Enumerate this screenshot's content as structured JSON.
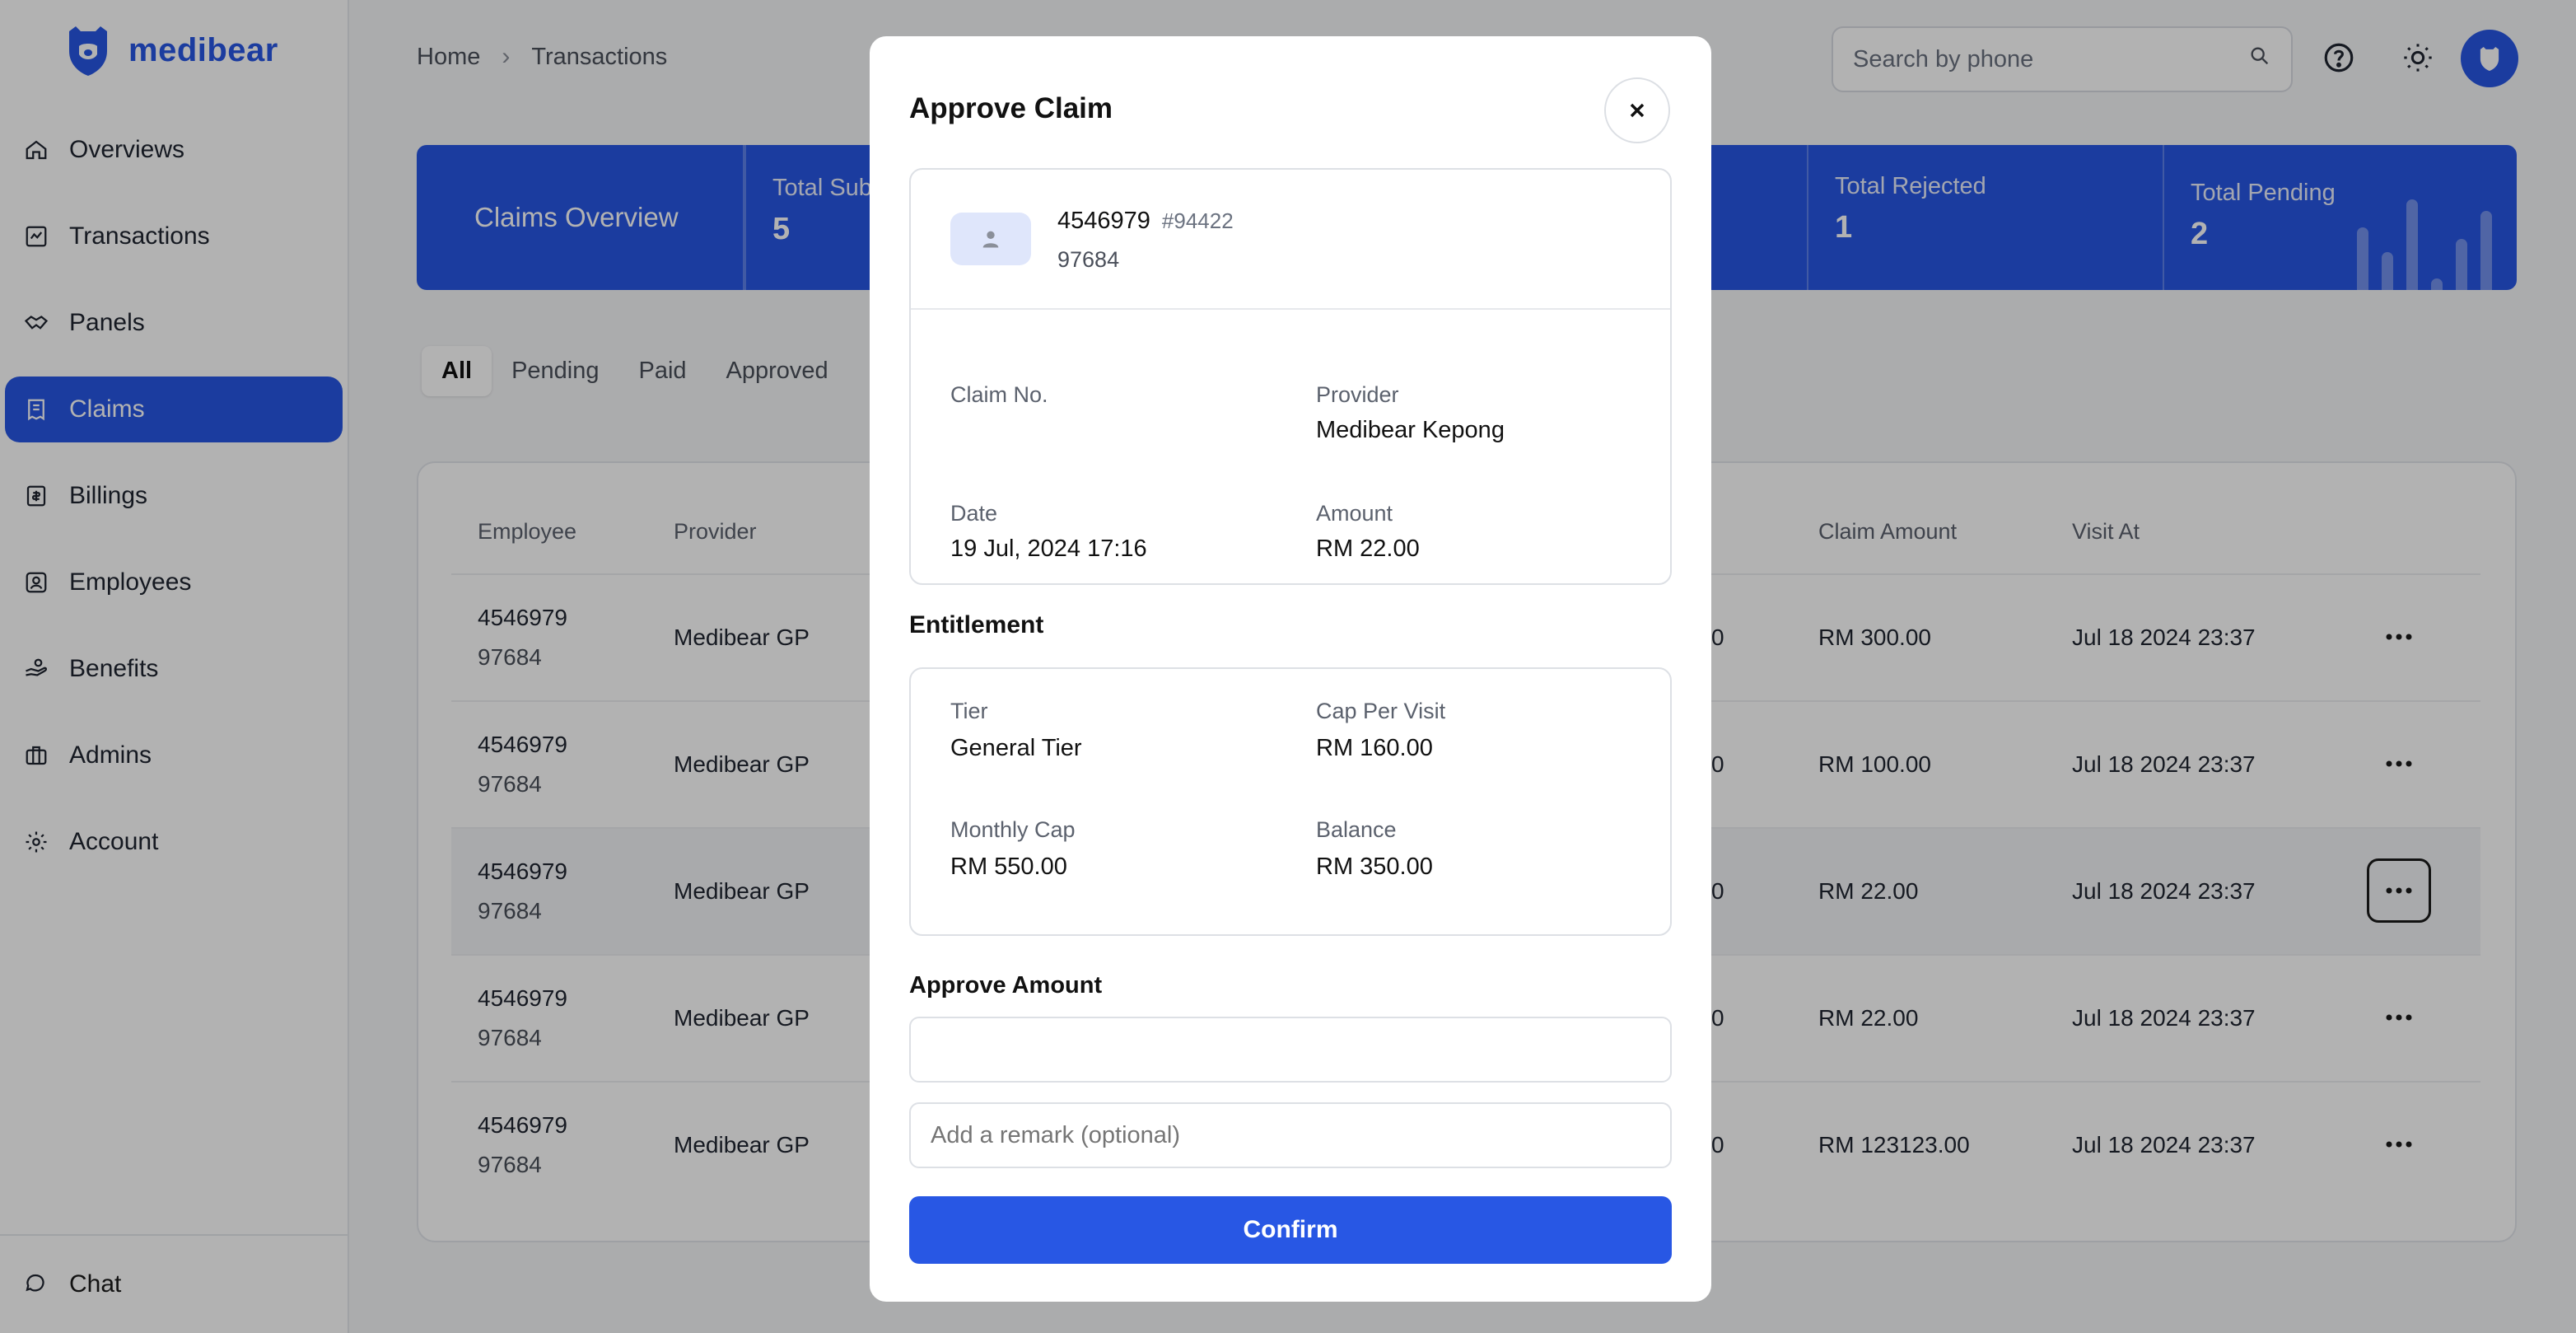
{
  "app": {
    "brand": "medibear",
    "accent": "#2857e4"
  },
  "sidebar": {
    "items": [
      {
        "label": "Overviews",
        "icon": "home-icon"
      },
      {
        "label": "Transactions",
        "icon": "transactions-icon"
      },
      {
        "label": "Panels",
        "icon": "handshake-icon"
      },
      {
        "label": "Claims",
        "icon": "receipt-icon",
        "active": true
      },
      {
        "label": "Billings",
        "icon": "billing-icon"
      },
      {
        "label": "Employees",
        "icon": "id-badge-icon"
      },
      {
        "label": "Benefits",
        "icon": "benefit-hand-icon"
      },
      {
        "label": "Admins",
        "icon": "briefcase-icon"
      },
      {
        "label": "Account",
        "icon": "gear-icon"
      }
    ],
    "footer": {
      "label": "Chat",
      "icon": "chat-icon"
    }
  },
  "header": {
    "breadcrumb": [
      "Home",
      "Transactions"
    ],
    "search_placeholder": "Search by phone"
  },
  "overview": {
    "title": "Claims Overview",
    "stats": [
      {
        "label": "Total Sub",
        "value": "5"
      },
      {
        "label": "Total Rejected",
        "value": "1"
      },
      {
        "label": "Total Pending",
        "value": "2"
      }
    ]
  },
  "filters": [
    "All",
    "Pending",
    "Paid",
    "Approved"
  ],
  "table": {
    "columns": [
      "Employee",
      "Provider",
      "Claim Amount",
      "Visit At"
    ],
    "rows": [
      {
        "employee": "4546979",
        "employee_sub": "97684",
        "provider": "Medibear GP",
        "partial": "0",
        "claim_amount": "RM 300.00",
        "visit_at": "Jul 18 2024 23:37"
      },
      {
        "employee": "4546979",
        "employee_sub": "97684",
        "provider": "Medibear GP",
        "partial": "0",
        "claim_amount": "RM 100.00",
        "visit_at": "Jul 18 2024 23:37"
      },
      {
        "employee": "4546979",
        "employee_sub": "97684",
        "provider": "Medibear GP",
        "partial": "0",
        "claim_amount": "RM 22.00",
        "visit_at": "Jul 18 2024 23:37"
      },
      {
        "employee": "4546979",
        "employee_sub": "97684",
        "provider": "Medibear GP",
        "partial": "0",
        "claim_amount": "RM 22.00",
        "visit_at": "Jul 18 2024 23:37"
      },
      {
        "employee": "4546979",
        "employee_sub": "97684",
        "provider": "Medibear GP",
        "partial": "0",
        "claim_amount": "RM 123123.00",
        "visit_at": "Jul 18 2024 23:37"
      }
    ]
  },
  "modal": {
    "title": "Approve Claim",
    "patient": {
      "name": "4546979",
      "code": "#94422",
      "id": "97684"
    },
    "claim": {
      "claim_no_label": "Claim No.",
      "claim_no": "",
      "provider_label": "Provider",
      "provider": "Medibear Kepong",
      "date_label": "Date",
      "date": "19 Jul, 2024 17:16",
      "amount_label": "Amount",
      "amount": "RM 22.00"
    },
    "entitlement_title": "Entitlement",
    "entitlement": {
      "tier_label": "Tier",
      "tier": "General Tier",
      "cap_label": "Cap Per Visit",
      "cap": "RM 160.00",
      "monthly_label": "Monthly Cap",
      "monthly": "RM 550.00",
      "balance_label": "Balance",
      "balance": "RM 350.00"
    },
    "approve_amount_label": "Approve Amount",
    "approve_amount_value": "",
    "remark_placeholder": "Add a remark (optional)",
    "confirm_label": "Confirm"
  }
}
